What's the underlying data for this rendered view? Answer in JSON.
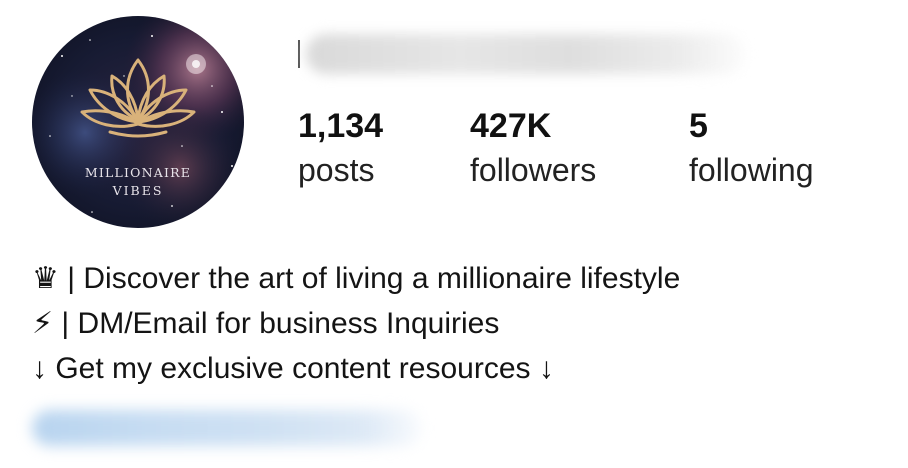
{
  "profile": {
    "avatar_text": {
      "line1": "MILLIONAIRE",
      "line2": "VIBES"
    },
    "colors": {
      "avatar_gold": "#d9b27a",
      "avatar_space_dark": "#141a33",
      "avatar_nebula": "#7a4a6a",
      "username_blur": "#dcdcdc",
      "link_blur": "#c4daf1"
    },
    "stats": [
      {
        "count": "1,134",
        "label": "posts"
      },
      {
        "count": "427K",
        "label": "followers"
      },
      {
        "count": "5",
        "label": "following"
      }
    ],
    "bio": [
      {
        "icon": "♛",
        "text": " | Discover the art of living a millionaire lifestyle"
      },
      {
        "icon": "⚡︎",
        "text": " | DM/Email for business Inquiries"
      },
      {
        "icon": "",
        "text": "↓ Get my exclusive content resources ↓"
      }
    ]
  }
}
